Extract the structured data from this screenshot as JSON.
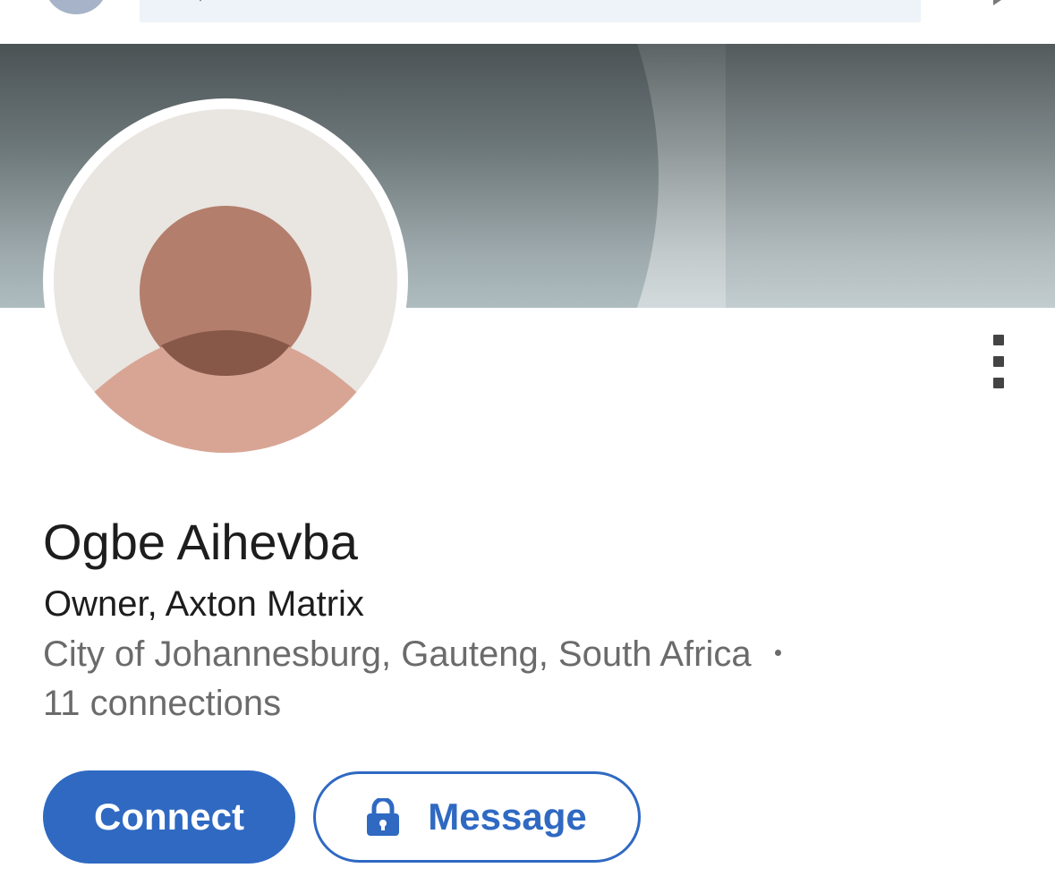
{
  "header": {
    "avatar_icon": "user-avatar",
    "search_placeholder": "",
    "right_icon": "send-icon"
  },
  "profile": {
    "name": "Ogbe Aihevba",
    "headline": "Owner, Axton Matrix",
    "location": "City of Johannesburg, Gauteng, South Africa",
    "connections": "11 connections",
    "avatar_icon": "default-person-avatar"
  },
  "actions": {
    "connect_label": "Connect",
    "message_label": "Message",
    "message_icon": "lock-icon",
    "more_icon": "more-vertical-icon"
  },
  "colors": {
    "primary": "#2f69c2",
    "text_primary": "#1d1d1d",
    "text_secondary": "#6b6b6b",
    "avatar_bg": "#e9e5e1",
    "avatar_head": "#b37e6c",
    "avatar_body": "#d8a594"
  }
}
